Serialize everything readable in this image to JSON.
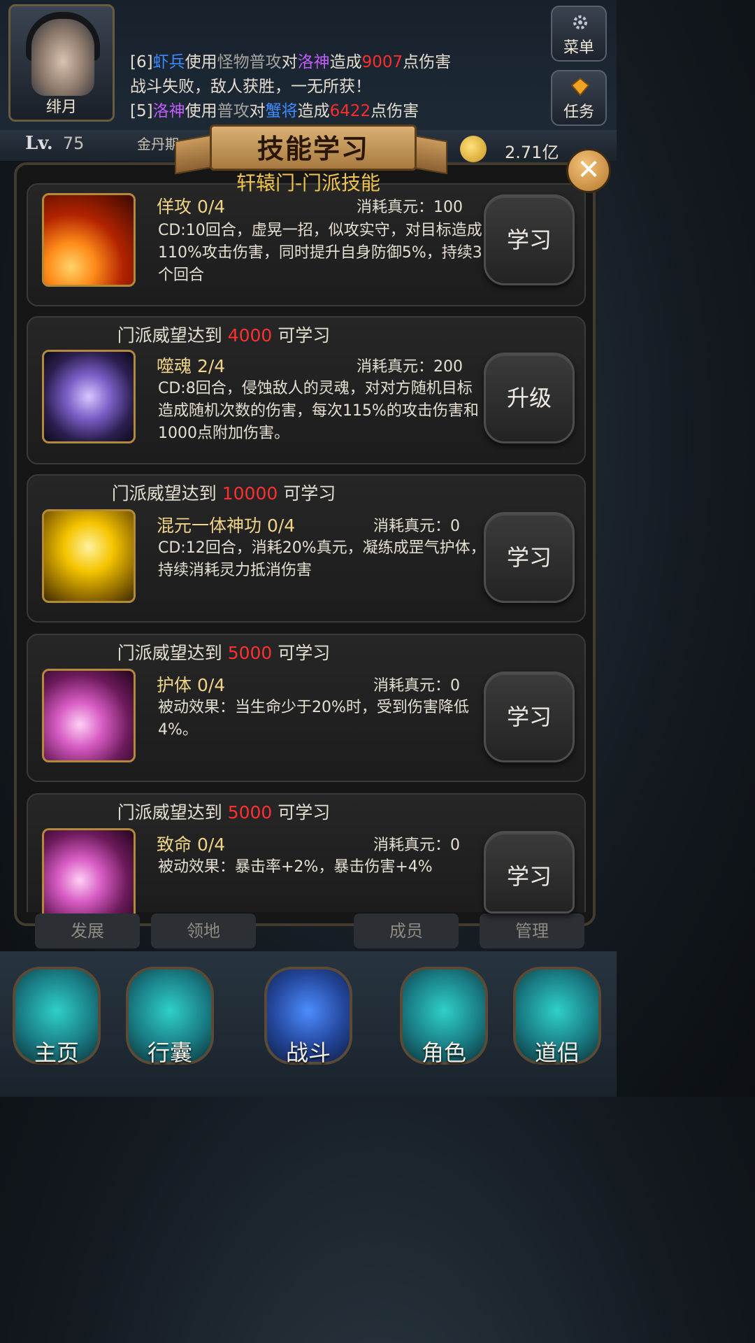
{
  "player": {
    "name": "绯月",
    "level_label": "Lv.",
    "level": "75",
    "realm": "金丹期",
    "currency": "2.71亿"
  },
  "side_buttons": {
    "menu": "菜单",
    "quest": "任务"
  },
  "battle_log": [
    {
      "prefix": "[6]",
      "actor": "虾兵",
      "verb": "使用",
      "skill": "怪物普攻",
      "to": "对",
      "target": "洛神",
      "result": "造成",
      "damage": "9007",
      "suffix": "点伤害"
    },
    {
      "text": "战斗失败，敌人获胜，一无所获！"
    },
    {
      "prefix": "[5]",
      "actor": "洛神",
      "verb": "使用",
      "skill": "普攻",
      "to": "对",
      "target": "蟹将",
      "result": "造成",
      "damage": "6422",
      "suffix": "点伤害"
    }
  ],
  "panel": {
    "title": "技能学习",
    "subtitle": "轩辕门-门派技能",
    "close": "✕"
  },
  "skills": [
    {
      "requirement_prefix": "",
      "requirement_value": "",
      "requirement_suffix": "",
      "name": "佯攻 0/4",
      "cost": "消耗真元：100",
      "desc": "CD:10回合，虚晃一招，似攻实守，对目标造成110%攻击伤害，同时提升自身防御5%，持续3个回合",
      "action": "学习"
    },
    {
      "requirement_prefix": "门派威望达到 ",
      "requirement_value": "4000",
      "requirement_suffix": " 可学习",
      "name": "噬魂 2/4",
      "cost": "消耗真元：200",
      "desc": "CD:8回合，侵蚀敌人的灵魂，对对方随机目标造成随机次数的伤害，每次115%的攻击伤害和1000点附加伤害。",
      "action": "升级"
    },
    {
      "requirement_prefix": "门派威望达到 ",
      "requirement_value": "10000",
      "requirement_suffix": " 可学习",
      "name": "混元一体神功 0/4",
      "cost": "消耗真元：0",
      "desc": "CD:12回合，消耗20%真元，凝练成罡气护体，持续消耗灵力抵消伤害",
      "action": "学习"
    },
    {
      "requirement_prefix": "门派威望达到 ",
      "requirement_value": "5000",
      "requirement_suffix": " 可学习",
      "name": "护体 0/4",
      "cost": "消耗真元：0",
      "desc": "被动效果：当生命少于20%时，受到伤害降低4%。",
      "action": "学习"
    },
    {
      "requirement_prefix": "门派威望达到 ",
      "requirement_value": "5000",
      "requirement_suffix": " 可学习",
      "name": "致命 0/4",
      "cost": "消耗真元：0",
      "desc": "被动效果：暴击率+2%，暴击伤害+4%",
      "action": "学习"
    }
  ],
  "sub_tabs": [
    "发展",
    "领地",
    "成员",
    "管理"
  ],
  "nav": [
    "主页",
    "行囊",
    "战斗",
    "角色",
    "道侣"
  ],
  "colors": {
    "log_actor_blue": "#3e8bff",
    "log_skill_gray": "#a7a4a0",
    "log_target_purple": "#c35cff",
    "log_damage_red": "#ff2d2d",
    "requirement_red": "#ff3030",
    "subtitle_gold": "#f2c54a"
  },
  "icons": {
    "skill_0": "fire-slash-icon",
    "skill_1": "soul-vortex-icon",
    "skill_2": "golden-aura-icon",
    "skill_3": "pink-claw-icon",
    "skill_4": "pink-claw-icon",
    "menu": "gear-icon",
    "quest": "diamond-icon",
    "close": "close-icon",
    "currency": "coin-icon"
  }
}
